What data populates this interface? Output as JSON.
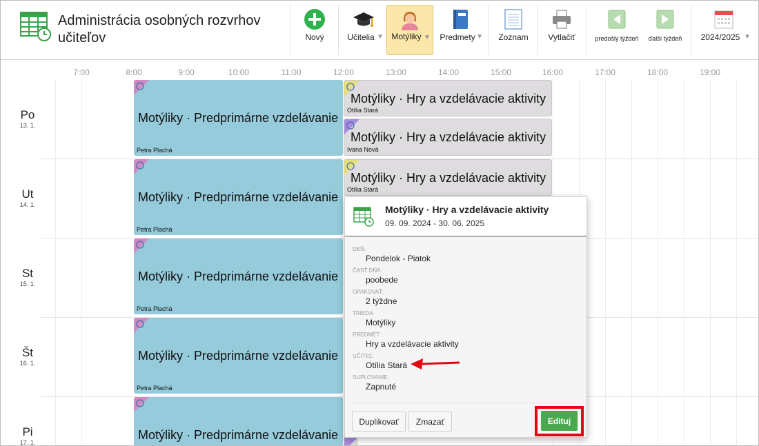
{
  "app": {
    "title": "Administrácia osobných rozvrhov učiteľov",
    "icon": "timetable-clock-icon"
  },
  "toolbar": {
    "new_label": "Nový",
    "teachers_label": "Učitelia",
    "classes_label": "Motýliky",
    "subjects_label": "Predmety",
    "list_label": "Zoznam",
    "print_label": "Vytlačiť",
    "prev_week_label": "predošlý týždeň",
    "next_week_label": "ďalší týždeň",
    "year_label": "2024/2025",
    "icons": [
      "plus-circle-icon",
      "graduation-cap-icon",
      "student-girl-icon",
      "book-icon",
      "list-page-icon",
      "printer-icon",
      "prev-arrow-icon",
      "next-arrow-icon",
      "calendar-icon"
    ]
  },
  "hours": [
    "7:00",
    "8:00",
    "9:00",
    "10:00",
    "11:00",
    "12:00",
    "13:00",
    "14:00",
    "15:00",
    "16:00",
    "17:00",
    "18:00",
    "19:00"
  ],
  "days": [
    {
      "name": "Po",
      "date": "13. 1."
    },
    {
      "name": "Ut",
      "date": "14. 1."
    },
    {
      "name": "St",
      "date": "15. 1."
    },
    {
      "name": "Št",
      "date": "16. 1."
    },
    {
      "name": "Pi",
      "date": "17. 1."
    }
  ],
  "events": {
    "morning_title": "Motýliky · Predprimárne vzdelávanie",
    "morning_teacher": "Petra Plachá",
    "afternoon_title": "Motýliky · Hry a vzdelávacie aktivity",
    "afternoon_teacher_a": "Otília Stará",
    "afternoon_teacher_b": "Ivana Nová"
  },
  "popup": {
    "title": "Motýliky · Hry a vzdelávacie aktivity",
    "dates": "09. 09. 2024 - 30. 06. 2025",
    "fields": [
      {
        "label": "DEŇ:",
        "value": "Pondelok - Piatok"
      },
      {
        "label": "ČASŤ DŇA:",
        "value": "poobede"
      },
      {
        "label": "OPAKOVAŤ:",
        "value": "2 týždne"
      },
      {
        "label": "TRIEDA:",
        "value": "Motýliky"
      },
      {
        "label": "PREDMET:",
        "value": "Hry a vzdelávacie aktivity"
      },
      {
        "label": "UČITEĽ:",
        "value": "Otília Stará"
      },
      {
        "label": "SUPLOVANIE:",
        "value": "Zapnuté"
      }
    ],
    "duplicate_label": "Duplikovať",
    "delete_label": "Zmazať",
    "edit_label": "Edituj"
  },
  "colors": {
    "morning": "#96cbdb",
    "afternoon": "#dedcdf",
    "active_tab": "#fbe7a9",
    "edit_button": "#4aa84e",
    "highlight": "#e30613"
  }
}
